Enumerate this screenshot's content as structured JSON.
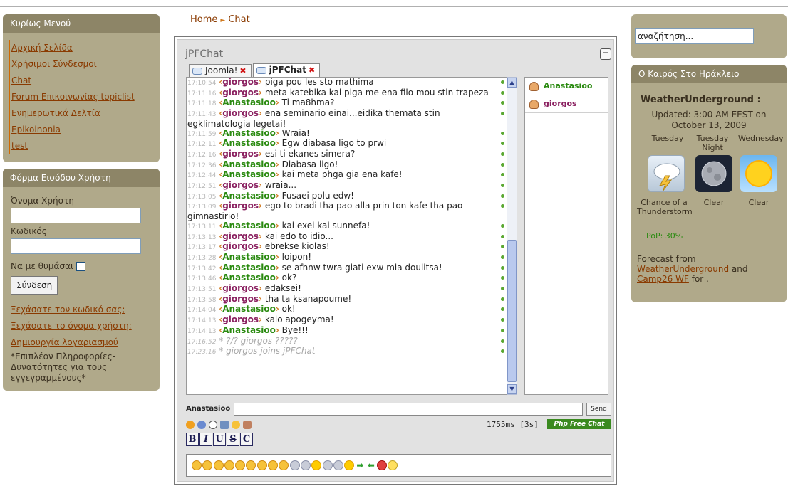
{
  "main_menu": {
    "title": "Κυρίως Μενού",
    "items": [
      {
        "label": "Αρχική Σελίδα"
      },
      {
        "label": "Χρήσιμοι Σύνδεσμοι"
      },
      {
        "label": "Chat"
      },
      {
        "label": "Forum Επικοινωνίας topiclist"
      },
      {
        "label": "Ενημερωτικά Δελτία"
      },
      {
        "label": "Epikoinonia"
      },
      {
        "label": "test"
      }
    ]
  },
  "login": {
    "title": "Φόρμα Εισόδου Χρήστη",
    "username_label": "Όνομα Χρήστη",
    "password_label": "Κωδικός",
    "remember_label": "Να με θυμάσαι",
    "submit_label": "Σύνδεση",
    "forgot_password": "Ξεχάσατε τον κωδικό σας;",
    "forgot_username": "Ξεχάσατε το όνομα χρήστη;",
    "create_account": "Δημιουργία λογαριασμού",
    "note": "*Επιπλέον Πληροφορίες-Δυνατότητες για τους εγγεγραμμένους*"
  },
  "breadcrumb": {
    "home": "Home",
    "current": "Chat"
  },
  "chat": {
    "title": "jPFChat",
    "minimize_label": "−",
    "tabs": [
      {
        "label": "Joomla!",
        "active": false
      },
      {
        "label": "jPFChat",
        "active": true
      }
    ],
    "messages": [
      {
        "time": "17:10:54",
        "nick": "giorgos",
        "text": "piga pou les sto mathima"
      },
      {
        "time": "17:11:16",
        "nick": "giorgos",
        "text": "meta katebika kai piga me ena filo mou stin trapeza"
      },
      {
        "time": "17:11:18",
        "nick": "Anastasioo",
        "text": "Ti ma8hma?"
      },
      {
        "time": "17:11:43",
        "nick": "giorgos",
        "text": "ena seminario einai...eidika themata stin egklimatologia legetai!"
      },
      {
        "time": "17:11:59",
        "nick": "Anastasioo",
        "text": "Wraia!"
      },
      {
        "time": "17:12:11",
        "nick": "Anastasioo",
        "text": "Egw diabasa ligo to prwi"
      },
      {
        "time": "17:12:16",
        "nick": "giorgos",
        "text": "esi ti ekanes simera?"
      },
      {
        "time": "17:12:36",
        "nick": "Anastasioo",
        "text": "Diabasa ligo!"
      },
      {
        "time": "17:12:44",
        "nick": "Anastasioo",
        "text": "kai meta phga gia ena kafe!"
      },
      {
        "time": "17:12:51",
        "nick": "giorgos",
        "text": "wraia..."
      },
      {
        "time": "17:13:05",
        "nick": "Anastasioo",
        "text": "Fusaei polu edw!"
      },
      {
        "time": "17:13:09",
        "nick": "giorgos",
        "text": "ego to bradi tha pao alla prin ton kafe tha pao gimnastirio!"
      },
      {
        "time": "17:13:11",
        "nick": "Anastasioo",
        "text": "kai exei kai sunnefa!"
      },
      {
        "time": "17:13:13",
        "nick": "giorgos",
        "text": "kai edo to idio..."
      },
      {
        "time": "17:13:17",
        "nick": "giorgos",
        "text": "ebrekse kiolas!"
      },
      {
        "time": "17:13:28",
        "nick": "Anastasioo",
        "text": "loipon!"
      },
      {
        "time": "17:13:42",
        "nick": "Anastasioo",
        "text": "se afhnw twra giati exw mia doulitsa!"
      },
      {
        "time": "17:13:46",
        "nick": "Anastasioo",
        "text": "ok?"
      },
      {
        "time": "17:13:51",
        "nick": "giorgos",
        "text": "edaksei!"
      },
      {
        "time": "17:13:58",
        "nick": "giorgos",
        "text": "tha ta ksanapoume!"
      },
      {
        "time": "17:14:04",
        "nick": "Anastasioo",
        "text": "ok!"
      },
      {
        "time": "17:14:13",
        "nick": "giorgos",
        "text": "kalo apogeyma!"
      },
      {
        "time": "17:14:13",
        "nick": "Anastasioo",
        "text": "Bye!!!"
      }
    ],
    "system_messages": [
      {
        "time": "17:16:52",
        "text": "* ?/? giorgos ?????"
      },
      {
        "time": "17:23:16",
        "text": "* giorgos joins jPFChat"
      }
    ],
    "users": [
      {
        "name": "Anastasioo"
      },
      {
        "name": "giorgos"
      }
    ],
    "my_nick": "Anastasioo",
    "send_label": "Send",
    "stats": "1755ms [3s]",
    "powered_by": "Php Free Chat",
    "format_buttons": [
      "B",
      "I",
      "U",
      "S",
      "C"
    ]
  },
  "search": {
    "value": "αναζήτηση..."
  },
  "weather": {
    "panel_title": "Ο Καιρός Στο Ηράκλειο",
    "source_title": "WeatherUnderground :",
    "updated": "Updated: 3:00 AM EEST on October 13, 2009",
    "days": [
      {
        "name": "Tuesday",
        "condition": "Chance of a Thunderstorm",
        "icon": "thunderstorm-icon"
      },
      {
        "name": "Tuesday Night",
        "condition": "Clear",
        "icon": "moon-icon"
      },
      {
        "name": "Wednesday",
        "condition": "Clear",
        "icon": "sun-icon"
      }
    ],
    "pop": "PoP: 30%",
    "forecast_prefix": "Forecast from",
    "forecast_link1": "WeatherUnderground",
    "forecast_and": "and",
    "forecast_link2": "Camp26 WF",
    "forecast_suffix": "for ."
  }
}
